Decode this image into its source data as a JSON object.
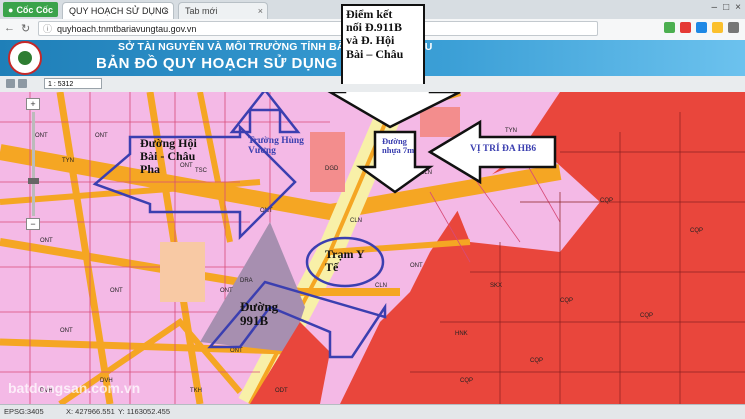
{
  "browser": {
    "brand": "Cốc Cốc",
    "tabs": [
      {
        "label": "QUY HOẠCH SỬ DỤNG"
      },
      {
        "label": "Tab mới"
      }
    ],
    "url": "quyhoach.tnmtbariavungtau.gov.vn"
  },
  "banner": {
    "line1": "SỞ TÀI NGUYÊN VÀ MÔI TRƯỜNG TỈNH BÀ RỊA - VŨNG TÀU",
    "line2": "BẢN ĐỒ QUY HOẠCH SỬ DỤNG ĐẤT"
  },
  "toolbar": {
    "scale": "1 : 5312"
  },
  "zoom": {
    "plus": "+",
    "minus": "−"
  },
  "annotations": {
    "diem_ket_noi": [
      "Điểm kết",
      "nối Đ.911B",
      "và Đ. Hội",
      "Bài – Châu"
    ],
    "vi_tri": "VỊ TRÍ ĐA HB6",
    "duong_hoi_bai": [
      "Đường Hội",
      "Bài - Châu",
      "Pha"
    ],
    "truong_hung_vuong": [
      "Trường Hùng",
      "Vương"
    ],
    "duong_nhua": [
      "Đường",
      "nhựa 7m"
    ],
    "tram_y_te": [
      "Trạm Y",
      "Tế"
    ],
    "duong_991b": [
      "Đường",
      "991B"
    ]
  },
  "map_labels": [
    "ONT",
    "ONT",
    "ONT",
    "ONT",
    "ONT",
    "ONT",
    "ONT",
    "ONT",
    "ONT",
    "ONT",
    "CLN",
    "CLN",
    "CLN",
    "TYN",
    "TYN",
    "DGD",
    "TSC",
    "DRA",
    "CQP",
    "CQP",
    "CQP",
    "CQP",
    "CQP",
    "CQP",
    "SKX",
    "HNK",
    "DVH",
    "DVH",
    "TKH",
    "ODT"
  ],
  "statusbar": {
    "epsg": "EPSG:3405",
    "x": "X: 427966.551",
    "y": "Y: 1163052.455"
  },
  "watermark": "batdongsan.com.vn",
  "colors": {
    "residential": "#f4b9e6",
    "military": "#e9463c",
    "road": "#f5a623",
    "arrow": "#3b3fb0",
    "annotation_box": "#ffffff"
  }
}
